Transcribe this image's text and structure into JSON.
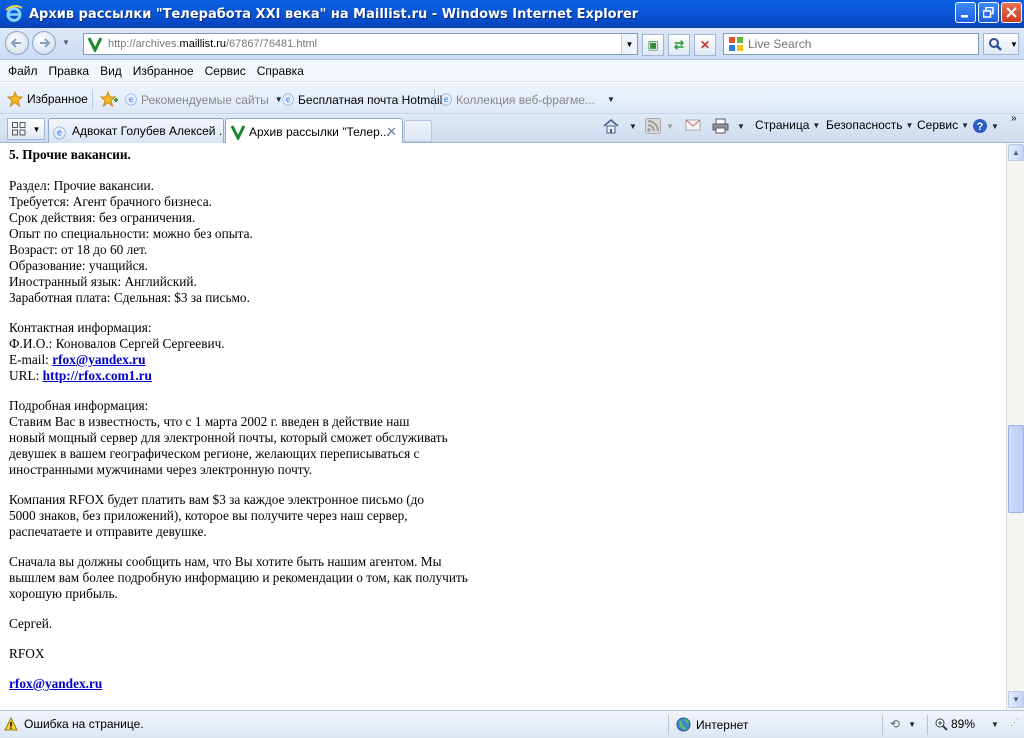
{
  "window": {
    "title": "Архив рассылки \"Телеработа XXI века\" на Maillist.ru - Windows Internet Explorer"
  },
  "address": {
    "url_prefix": "http://archives.",
    "url_domain": "maillist.ru",
    "url_suffix": "/67867/76481.html"
  },
  "search": {
    "placeholder": "Live Search"
  },
  "menu": {
    "file": "Файл",
    "edit": "Правка",
    "view": "Вид",
    "favorites": "Избранное",
    "tools": "Сервис",
    "help": "Справка"
  },
  "favbar": {
    "favorites": "Избранное",
    "suggested": "Рекомендуемые сайты",
    "hotmail": "Бесплатная почта Hotmail",
    "gallery": "Коллекция веб-фрагме..."
  },
  "tabs": [
    {
      "label": "Адвокат Голубев Алексей ..."
    },
    {
      "label": "Архив рассылки \"Телер..."
    }
  ],
  "commandbar": {
    "page": "Страница",
    "safety": "Безопасность",
    "tools": "Сервис"
  },
  "content": {
    "heading": "5. Прочие вакансии.",
    "details": [
      "Раздел: Прочие вакансии.",
      "Требуется: Агент брачного бизнеса.",
      "Срок действия: без ограничения.",
      "Опыт по специальности: можно без опыта.",
      "Возраст: от 18 до 60 лет.",
      "Образование: учащийся.",
      "Иностранный язык: Английский.",
      "Заработная плата: Сдельная: $3 за письмо."
    ],
    "contact_title": "Контактная информация:",
    "contact_name": "Ф.И.О.: Коновалов Сергей Сергеевич.",
    "email_label": "E-mail:",
    "email": "rfox@yandex.ru",
    "url_label": "URL:",
    "url": "http://rfox.com1.ru",
    "more_title": "Подробная информация:",
    "para1": [
      "Ставим Вас в известность, что с 1 марта 2002 г. введен в действие наш",
      "новый мощный сервер для электронной почты, который сможет обслуживать",
      "девушек в вашем географическом регионе, желающих переписываться с",
      "иностранными мужчинами через электронную почту."
    ],
    "para2": [
      "Компания RFOX будет платить вам $3 за каждое электронное письмо (до",
      "5000 знаков, без приложений), которое вы получите через наш сервер,",
      "распечатаете и отправите девушке."
    ],
    "para3": [
      "Сначала вы должны сообщить нам, что Вы хотите быть нашим агентом. Мы",
      "вышлем вам более подробную информацию и рекомендации о том, как получить",
      "хорошую прибыль."
    ],
    "sign1": "Сергей.",
    "sign2": "RFOX",
    "sign_email": "rfox@yandex.ru"
  },
  "status": {
    "message": "Ошибка на странице.",
    "zone": "Интернет",
    "zoom": "89%"
  },
  "colors": {
    "titlebar": "#0a58d8",
    "link": "#0000cc"
  }
}
